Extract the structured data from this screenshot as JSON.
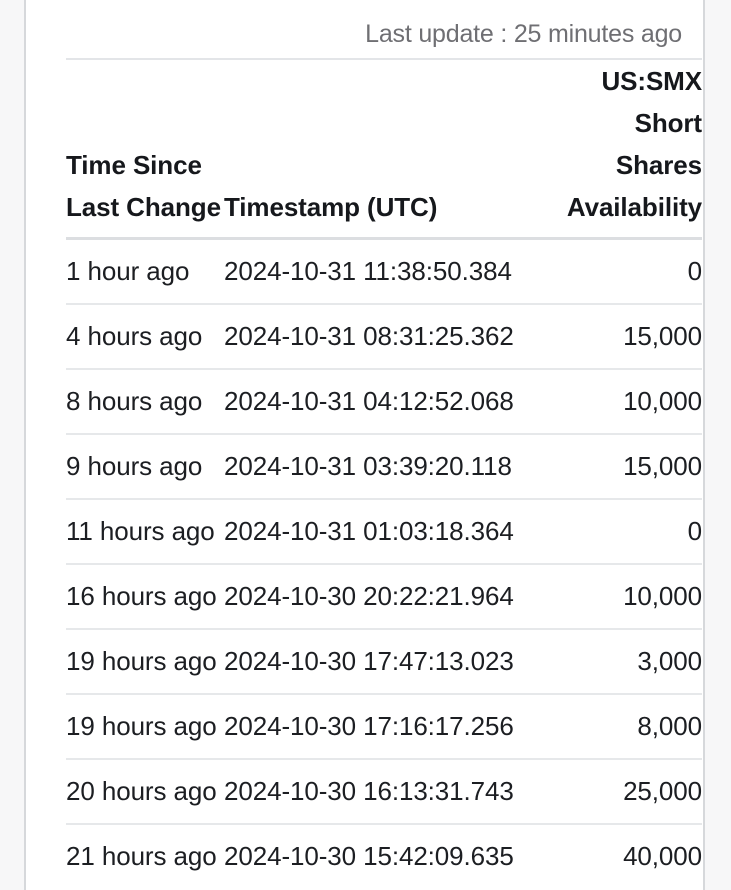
{
  "header": {
    "last_update_label": "Last update : 25 minutes ago"
  },
  "table": {
    "columns": [
      {
        "key": "time_since_last_change",
        "label": "Time Since Last Change",
        "align": "left"
      },
      {
        "key": "timestamp_utc",
        "label": "Timestamp (UTC)",
        "align": "left"
      },
      {
        "key": "short_shares_availability",
        "label": "US:SMX Short Shares Availability",
        "align": "right"
      }
    ],
    "rows": [
      {
        "time": "1 hour ago",
        "timestamp": "2024-10-31 11:38:50.384",
        "availability": "0"
      },
      {
        "time": "4 hours ago",
        "timestamp": "2024-10-31 08:31:25.362",
        "availability": "15,000"
      },
      {
        "time": "8 hours ago",
        "timestamp": "2024-10-31 04:12:52.068",
        "availability": "10,000"
      },
      {
        "time": "9 hours ago",
        "timestamp": "2024-10-31 03:39:20.118",
        "availability": "15,000"
      },
      {
        "time": "11 hours ago",
        "timestamp": "2024-10-31 01:03:18.364",
        "availability": "0"
      },
      {
        "time": "16 hours ago",
        "timestamp": "2024-10-30 20:22:21.964",
        "availability": "10,000"
      },
      {
        "time": "19 hours ago",
        "timestamp": "2024-10-30 17:47:13.023",
        "availability": "3,000"
      },
      {
        "time": "19 hours ago",
        "timestamp": "2024-10-30 17:16:17.256",
        "availability": "8,000"
      },
      {
        "time": "20 hours ago",
        "timestamp": "2024-10-30 16:13:31.743",
        "availability": "25,000"
      },
      {
        "time": "21 hours ago",
        "timestamp": "2024-10-30 15:42:09.635",
        "availability": "40,000"
      }
    ]
  },
  "colors": {
    "page_background": "#f7f7f8",
    "panel_background": "#ffffff",
    "panel_rule": "#d6d8db",
    "header_text": "#16181c",
    "body_text": "#1c1e22",
    "muted_text": "#6f6f73",
    "row_divider": "#e6e8ea",
    "header_divider": "#dcdee1"
  }
}
